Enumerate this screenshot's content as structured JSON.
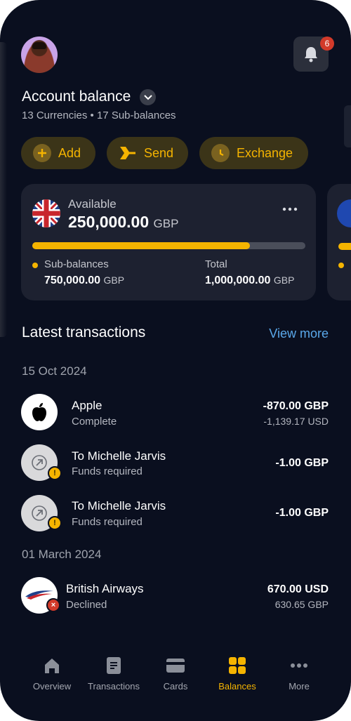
{
  "header": {
    "notification_count": "6"
  },
  "account": {
    "title": "Account balance",
    "subtitle": "13 Currencies • 17 Sub-balances"
  },
  "actions": [
    {
      "label": "Add",
      "icon": "plus-icon"
    },
    {
      "label": "Send",
      "icon": "send-icon"
    },
    {
      "label": "Exchange",
      "icon": "clock-icon"
    }
  ],
  "balance_card": {
    "flag": "uk-flag-icon",
    "available_label": "Available",
    "available_amount": "250,000.00",
    "currency": "GBP",
    "progress_fraction": 0.796,
    "sub_label": "Sub-balances",
    "sub_amount": "750,000.00",
    "total_label": "Total",
    "total_amount": "1,000,000.00"
  },
  "transactions": {
    "title": "Latest transactions",
    "view_more": "View more",
    "groups": [
      {
        "date": "15 Oct 2024",
        "items": [
          {
            "name": "Apple",
            "status": "Complete",
            "amount": "-870.00 GBP",
            "secondary": "-1,139.17 USD",
            "icon": "apple-icon"
          },
          {
            "name": "To Michelle Jarvis",
            "status": "Funds required",
            "amount": "-1.00 GBP",
            "icon": "arrow-out-icon",
            "badge": "!"
          },
          {
            "name": "To Michelle Jarvis",
            "status": "Funds required",
            "amount": "-1.00 GBP",
            "icon": "arrow-out-icon",
            "badge": "!"
          }
        ]
      },
      {
        "date": "01 March 2024",
        "items": [
          {
            "name": "British Airways",
            "status": "Declined",
            "amount": "670.00 USD",
            "secondary": "630.65 GBP",
            "icon": "british-airways-icon",
            "badge": "×"
          }
        ]
      }
    ]
  },
  "tabs": [
    {
      "label": "Overview",
      "icon": "home-icon"
    },
    {
      "label": "Transactions",
      "icon": "document-icon"
    },
    {
      "label": "Cards",
      "icon": "card-icon"
    },
    {
      "label": "Balances",
      "icon": "grid-icon",
      "active": true
    },
    {
      "label": "More",
      "icon": "more-icon"
    }
  ],
  "colors": {
    "background": "#0a0f1f",
    "accent": "#f5b400",
    "link": "#5aa8ea",
    "card": "#1d2130"
  }
}
